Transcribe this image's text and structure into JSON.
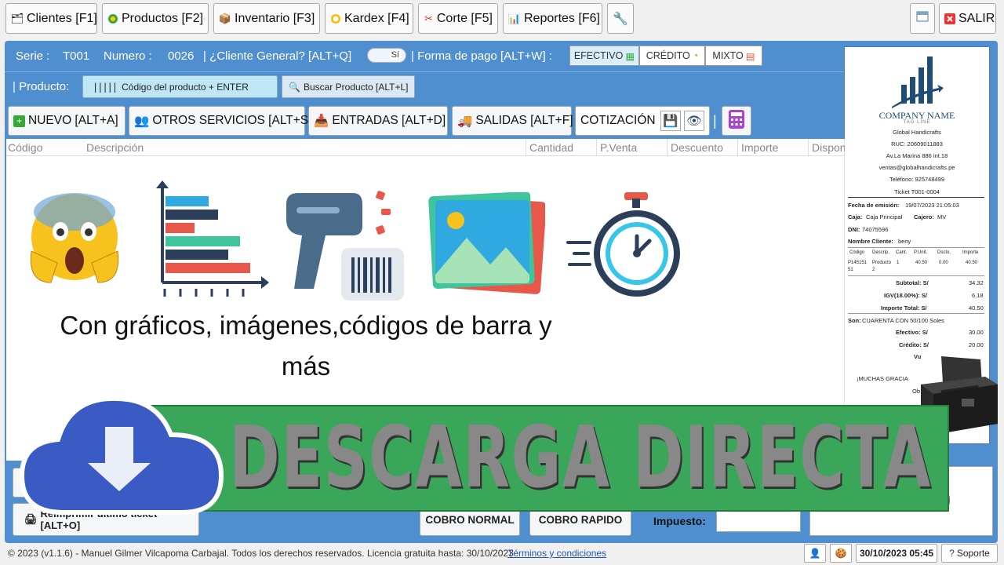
{
  "toolbar": {
    "clientes": "Clientes [F1]",
    "productos": "Productos [F2]",
    "inventario": "Inventario [F3]",
    "kardex": "Kardex [F4]",
    "corte": "Corte [F5]",
    "reportes": "Reportes [F6]",
    "salir": "SALIR"
  },
  "header": {
    "serie_label": "Serie :",
    "serie": "T001",
    "numero_label": "Numero :",
    "numero": "0026",
    "cliente_general": "| ¿Cliente General? [ALT+Q]",
    "si": "Sí",
    "forma_pago": "| Forma de pago [ALT+W] :",
    "efectivo": "EFECTIVO",
    "credito": "CRÉDITO",
    "mixto": "MIXTO"
  },
  "producto": {
    "label": "| Producto:",
    "placeholder": "Código del producto + ENTER",
    "buscar": "Buscar Producto [ALT+L]"
  },
  "actions": {
    "nuevo": "NUEVO [ALT+A]",
    "otros": "OTROS SERVICIOS [ALT+S]",
    "entradas": "ENTRADAS [ALT+D]",
    "salidas": "SALIDAS [ALT+F]",
    "cotizacion": "COTIZACIÓN",
    "sep": "|"
  },
  "columns": [
    "Código",
    "Descripción",
    "Cantidad",
    "P.Venta",
    "Descuento",
    "Importe",
    "Dispon"
  ],
  "promo": {
    "line1": "Con gráficos, imágenes,códigos de barra y",
    "line2": "más",
    "banner": "DESCARGA DIRECTA"
  },
  "bottom": {
    "reimprimir": "Reimprimir último ticket [ALT+O]",
    "cobro_normal": "COBRO NORMAL",
    "cobro_rapido": "COBRO RAPIDO",
    "impuesto": "Impuesto:",
    "total": "S/ 0.00"
  },
  "ticket": {
    "company": "COMPANY NAME",
    "tagline": "TAG LINE",
    "name": "Global Handicrafts",
    "ruc": "RUC: 20609011883",
    "address": "Av.La Marina 886 int.18",
    "email": "ventas@globalhandicrafts.pe",
    "phone": "Teléfono: 925748499",
    "ticket": "Ticket T001-0004",
    "fecha_l": "Fecha de emisión:",
    "fecha": "19/07/2023 21:05:03",
    "caja_l": "Caja:",
    "caja": "Caja Principal",
    "cajero_l": "Cajero:",
    "cajero": "MV",
    "dni_l": "DNI:",
    "dni": "74075596",
    "cliente_l": "Nombre Cliente:",
    "cliente": "beny",
    "cols": [
      "Código",
      "Descrip.",
      "Cant.",
      "P.Unit.",
      "Dscto.",
      "Importe"
    ],
    "row": [
      "P145151",
      "Producto",
      "1",
      "40.50",
      "0.00",
      "40.50"
    ],
    "row2": [
      "51",
      "2"
    ],
    "subtotal_l": "Subtotal: S/",
    "subtotal": "34.32",
    "igv_l": "IGV(18.00%): S/",
    "igv": "6.18",
    "total_l": "Importe Total: S/",
    "total": "40.50",
    "son": "Son:",
    "son_v": "CUARENTA CON 50/100 Soles",
    "efectivo_l": "Efectivo: S/",
    "efectivo": "30.00",
    "credito_l": "Crédito: S/",
    "credito": "20.00",
    "vu": "Vu",
    "gracias": "¡MUCHAS GRACIA",
    "ob": "Ob"
  },
  "status": {
    "copyright": "© 2023 (v1.1.6) - Manuel Gilmer Vilcapoma Carbajal. Todos los derechos reservados. Licencia gratuita hasta: 30/10/2023",
    "terms": "Términos y condiciones",
    "datetime": "30/10/2023 05:45",
    "soporte": "Soporte"
  },
  "colors": {
    "panel": "#4f8fd0",
    "banner": "#3aa65a",
    "cloud": "#3b5bc4"
  }
}
